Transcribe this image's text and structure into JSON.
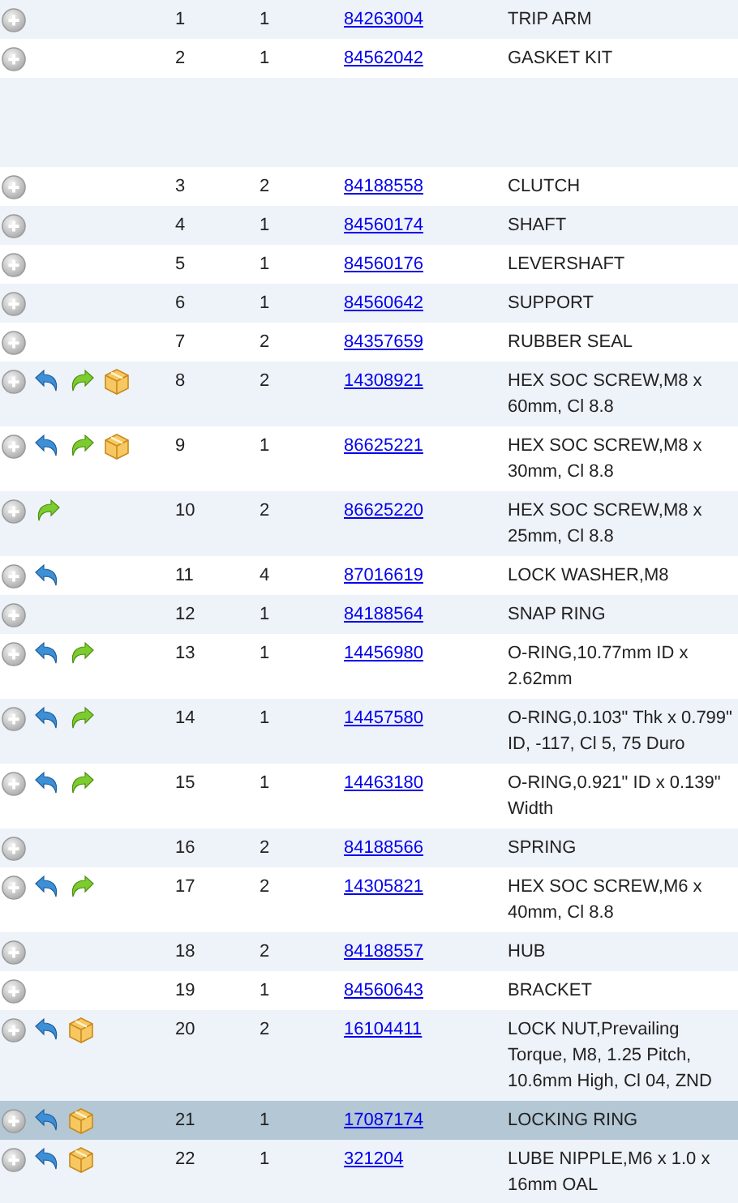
{
  "rows": [
    {
      "kind": "part",
      "back": false,
      "forward": false,
      "box": false,
      "number": "1",
      "qty": "1",
      "part_no": "84263004",
      "description": [
        "TRIP ARM"
      ],
      "selected": false
    },
    {
      "kind": "part",
      "back": false,
      "forward": false,
      "box": false,
      "number": "2",
      "qty": "1",
      "part_no": "84562042",
      "description": [
        "GASKET KIT"
      ],
      "selected": false
    },
    {
      "kind": "blank"
    },
    {
      "kind": "part",
      "back": false,
      "forward": false,
      "box": false,
      "number": "3",
      "qty": "2",
      "part_no": "84188558",
      "description": [
        "CLUTCH"
      ],
      "selected": false
    },
    {
      "kind": "part",
      "back": false,
      "forward": false,
      "box": false,
      "number": "4",
      "qty": "1",
      "part_no": "84560174",
      "description": [
        "SHAFT"
      ],
      "selected": false
    },
    {
      "kind": "part",
      "back": false,
      "forward": false,
      "box": false,
      "number": "5",
      "qty": "1",
      "part_no": "84560176",
      "description": [
        "LEVERSHAFT"
      ],
      "selected": false
    },
    {
      "kind": "part",
      "back": false,
      "forward": false,
      "box": false,
      "number": "6",
      "qty": "1",
      "part_no": "84560642",
      "description": [
        "SUPPORT"
      ],
      "selected": false
    },
    {
      "kind": "part",
      "back": false,
      "forward": false,
      "box": false,
      "number": "7",
      "qty": "2",
      "part_no": "84357659",
      "description": [
        "RUBBER SEAL"
      ],
      "selected": false
    },
    {
      "kind": "part",
      "back": true,
      "forward": true,
      "box": true,
      "number": "8",
      "qty": "2",
      "part_no": "14308921",
      "description": [
        "HEX SOC SCREW,M8 x",
        "60mm, Cl 8.8"
      ],
      "selected": false
    },
    {
      "kind": "part",
      "back": true,
      "forward": true,
      "box": true,
      "number": "9",
      "qty": "1",
      "part_no": "86625221",
      "description": [
        "HEX SOC SCREW,M8 x",
        "30mm, Cl 8.8"
      ],
      "selected": false
    },
    {
      "kind": "part",
      "back": false,
      "forward": true,
      "box": false,
      "number": "10",
      "qty": "2",
      "part_no": "86625220",
      "description": [
        "HEX SOC SCREW,M8 x",
        "25mm, Cl 8.8"
      ],
      "selected": false
    },
    {
      "kind": "part",
      "back": true,
      "forward": false,
      "box": false,
      "number": "11",
      "qty": "4",
      "part_no": "87016619",
      "description": [
        "LOCK WASHER,M8"
      ],
      "selected": false
    },
    {
      "kind": "part",
      "back": false,
      "forward": false,
      "box": false,
      "number": "12",
      "qty": "1",
      "part_no": "84188564",
      "description": [
        "SNAP RING"
      ],
      "selected": false
    },
    {
      "kind": "part",
      "back": true,
      "forward": true,
      "box": false,
      "number": "13",
      "qty": "1",
      "part_no": "14456980",
      "description": [
        "O-RING,10.77mm ID x",
        "2.62mm"
      ],
      "selected": false
    },
    {
      "kind": "part",
      "back": true,
      "forward": true,
      "box": false,
      "number": "14",
      "qty": "1",
      "part_no": "14457580",
      "description": [
        "O-RING,0.103\" Thk x 0.799\"",
        "ID, -117, Cl 5, 75 Duro"
      ],
      "selected": false
    },
    {
      "kind": "part",
      "back": true,
      "forward": true,
      "box": false,
      "number": "15",
      "qty": "1",
      "part_no": "14463180",
      "description": [
        "O-RING,0.921\" ID x 0.139\"",
        "Width"
      ],
      "selected": false
    },
    {
      "kind": "part",
      "back": false,
      "forward": false,
      "box": false,
      "number": "16",
      "qty": "2",
      "part_no": "84188566",
      "description": [
        "SPRING"
      ],
      "selected": false
    },
    {
      "kind": "part",
      "back": true,
      "forward": true,
      "box": false,
      "number": "17",
      "qty": "2",
      "part_no": "14305821",
      "description": [
        "HEX SOC SCREW,M6 x",
        "40mm, Cl 8.8"
      ],
      "selected": false
    },
    {
      "kind": "part",
      "back": false,
      "forward": false,
      "box": false,
      "number": "18",
      "qty": "2",
      "part_no": "84188557",
      "description": [
        "HUB"
      ],
      "selected": false
    },
    {
      "kind": "part",
      "back": false,
      "forward": false,
      "box": false,
      "number": "19",
      "qty": "1",
      "part_no": "84560643",
      "description": [
        "BRACKET"
      ],
      "selected": false
    },
    {
      "kind": "part",
      "back": true,
      "forward": false,
      "box": true,
      "number": "20",
      "qty": "2",
      "part_no": "16104411",
      "description": [
        "LOCK NUT,Prevailing",
        "Torque, M8, 1.25 Pitch,",
        "10.6mm High, Cl 04, ZND"
      ],
      "selected": false
    },
    {
      "kind": "part",
      "back": true,
      "forward": false,
      "box": true,
      "number": "21",
      "qty": "1",
      "part_no": "17087174",
      "description": [
        "LOCKING RING"
      ],
      "selected": true
    },
    {
      "kind": "part",
      "back": true,
      "forward": false,
      "box": true,
      "number": "22",
      "qty": "1",
      "part_no": "321204",
      "description": [
        "LUBE NIPPLE,M6 x 1.0 x",
        "16mm OAL"
      ],
      "selected": false
    }
  ]
}
